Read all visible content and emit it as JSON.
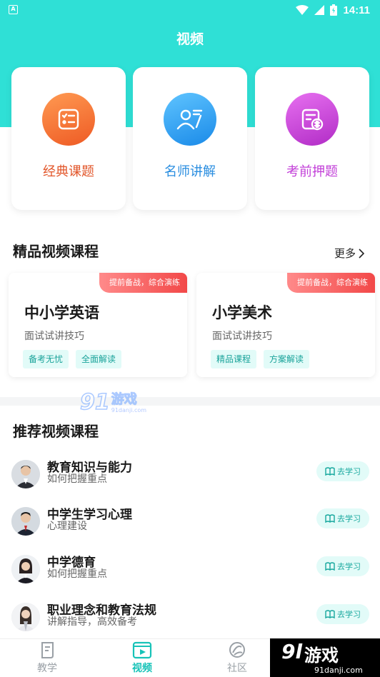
{
  "status_bar": {
    "time": "14:11",
    "notification_icon": "A"
  },
  "header": {
    "title": "视频"
  },
  "categories": [
    {
      "label": "经典课题",
      "icon": "checklist-icon",
      "color": "#f26a2e",
      "text_color": "#e2562a"
    },
    {
      "label": "名师讲解",
      "icon": "teacher-icon",
      "color": "#2a9ef0",
      "text_color": "#2a8ee0"
    },
    {
      "label": "考前押题",
      "icon": "exam-icon",
      "color": "#c73fd6",
      "text_color": "#c23fd8"
    }
  ],
  "premium": {
    "title": "精品视频课程",
    "more_label": "更多",
    "courses": [
      {
        "ribbon": "提前备战，综合演练",
        "title": "中小学英语",
        "subtitle": "面试试讲技巧",
        "tags": [
          "备考无忧",
          "全面解读"
        ]
      },
      {
        "ribbon": "提前备战，综合演练",
        "title": "小学美术",
        "subtitle": "面试试讲技巧",
        "tags": [
          "精品课程",
          "方案解读"
        ]
      }
    ]
  },
  "watermark": {
    "number": "91",
    "text": "游戏",
    "url": "91danji.com"
  },
  "recommended": {
    "title": "推荐视频课程",
    "items": [
      {
        "title": "教育知识与能力",
        "subtitle": "如何把握重点",
        "button": "去学习"
      },
      {
        "title": "中学生学习心理",
        "subtitle": "心理建设",
        "button": "去学习"
      },
      {
        "title": "中学德育",
        "subtitle": "如何把握重点",
        "button": "去学习"
      },
      {
        "title": "职业理念和教育法规",
        "subtitle": "讲解指导，高效备考",
        "button": "去学习"
      }
    ]
  },
  "tabs": [
    {
      "label": "教学",
      "icon": "book-icon",
      "active": false
    },
    {
      "label": "视频",
      "icon": "video-icon",
      "active": true
    },
    {
      "label": "社区",
      "icon": "community-icon",
      "active": false
    }
  ],
  "corner_logo": {
    "number": "9l",
    "text": "游戏",
    "url": "91danji.com"
  },
  "colors": {
    "accent": "#2fe0d6",
    "tab_active": "#17c3b8",
    "ribbon": "#f24848",
    "tag_bg": "#e2fbf8"
  }
}
